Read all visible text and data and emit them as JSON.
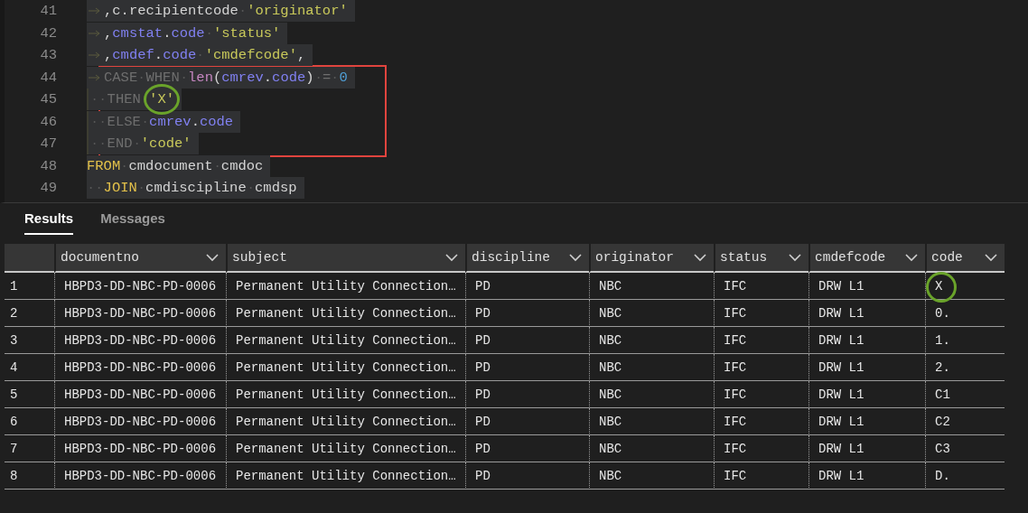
{
  "editor": {
    "lines": [
      {
        "number": "41",
        "tokens": [
          {
            "kind": "tab"
          },
          {
            "kind": "plain",
            "text": ",c.recipientcode"
          },
          {
            "kind": "space"
          },
          {
            "kind": "string",
            "text": "'originator'"
          }
        ]
      },
      {
        "number": "42",
        "tokens": [
          {
            "kind": "tab"
          },
          {
            "kind": "plain",
            "text": ","
          },
          {
            "kind": "ident",
            "text": "cmstat"
          },
          {
            "kind": "plain",
            "text": "."
          },
          {
            "kind": "ident",
            "text": "code"
          },
          {
            "kind": "space"
          },
          {
            "kind": "string",
            "text": "'status'"
          }
        ]
      },
      {
        "number": "43",
        "tokens": [
          {
            "kind": "tab"
          },
          {
            "kind": "plain",
            "text": ","
          },
          {
            "kind": "ident",
            "text": "cmdef"
          },
          {
            "kind": "plain",
            "text": "."
          },
          {
            "kind": "ident",
            "text": "code"
          },
          {
            "kind": "space"
          },
          {
            "kind": "string",
            "text": "'cmdefcode'"
          },
          {
            "kind": "plain",
            "text": ","
          }
        ]
      },
      {
        "number": "44",
        "boxed": true,
        "tokens": [
          {
            "kind": "tab"
          },
          {
            "kind": "dim",
            "text": "CASE"
          },
          {
            "kind": "space"
          },
          {
            "kind": "dim",
            "text": "WHEN"
          },
          {
            "kind": "space"
          },
          {
            "kind": "fn",
            "text": "len"
          },
          {
            "kind": "plain",
            "text": "("
          },
          {
            "kind": "ident",
            "text": "cmrev"
          },
          {
            "kind": "plain",
            "text": "."
          },
          {
            "kind": "ident",
            "text": "code"
          },
          {
            "kind": "plain",
            "text": ")"
          },
          {
            "kind": "space"
          },
          {
            "kind": "dim",
            "text": "="
          },
          {
            "kind": "space"
          },
          {
            "kind": "number",
            "text": "0"
          }
        ]
      },
      {
        "number": "45",
        "boxed": true,
        "tokens": [
          {
            "kind": "guide"
          },
          {
            "kind": "space"
          },
          {
            "kind": "space"
          },
          {
            "kind": "dim",
            "text": "THEN"
          },
          {
            "kind": "space"
          },
          {
            "kind": "string",
            "text": "'X'",
            "circled": true
          }
        ]
      },
      {
        "number": "46",
        "boxed": true,
        "tokens": [
          {
            "kind": "guide"
          },
          {
            "kind": "space"
          },
          {
            "kind": "space"
          },
          {
            "kind": "dim",
            "text": "ELSE"
          },
          {
            "kind": "space"
          },
          {
            "kind": "ident",
            "text": "cmrev"
          },
          {
            "kind": "plain",
            "text": "."
          },
          {
            "kind": "ident",
            "text": "code"
          }
        ]
      },
      {
        "number": "47",
        "boxed": true,
        "tokens": [
          {
            "kind": "guide"
          },
          {
            "kind": "space"
          },
          {
            "kind": "space"
          },
          {
            "kind": "dim",
            "text": "END"
          },
          {
            "kind": "space"
          },
          {
            "kind": "string",
            "text": "'code'"
          }
        ]
      },
      {
        "number": "48",
        "tokens": [
          {
            "kind": "keyword",
            "text": "FROM"
          },
          {
            "kind": "space"
          },
          {
            "kind": "plain",
            "text": "cmdocument"
          },
          {
            "kind": "space"
          },
          {
            "kind": "plain",
            "text": "cmdoc"
          }
        ]
      },
      {
        "number": "49",
        "tokens": [
          {
            "kind": "space"
          },
          {
            "kind": "space"
          },
          {
            "kind": "keyword",
            "text": "JOIN"
          },
          {
            "kind": "space"
          },
          {
            "kind": "plain",
            "text": "cmdiscipline"
          },
          {
            "kind": "space"
          },
          {
            "kind": "plain",
            "text": "cmdsp"
          }
        ]
      }
    ]
  },
  "result_tabs": [
    {
      "label": "Results",
      "selected": true
    },
    {
      "label": "Messages",
      "selected": false
    }
  ],
  "table": {
    "columns": [
      "documentno",
      "subject",
      "discipline",
      "originator",
      "status",
      "cmdefcode",
      "code"
    ],
    "rows": [
      {
        "number": "1",
        "cells": [
          "HBPD3-DD-NBC-PD-0006",
          "Permanent Utility Connection…",
          "PD",
          "NBC",
          "IFC",
          "DRW L1",
          "X"
        ],
        "code_circled": true
      },
      {
        "number": "2",
        "cells": [
          "HBPD3-DD-NBC-PD-0006",
          "Permanent Utility Connection…",
          "PD",
          "NBC",
          "IFC",
          "DRW L1",
          "0."
        ],
        "code_circled": false
      },
      {
        "number": "3",
        "cells": [
          "HBPD3-DD-NBC-PD-0006",
          "Permanent Utility Connection…",
          "PD",
          "NBC",
          "IFC",
          "DRW L1",
          "1."
        ],
        "code_circled": false
      },
      {
        "number": "4",
        "cells": [
          "HBPD3-DD-NBC-PD-0006",
          "Permanent Utility Connection…",
          "PD",
          "NBC",
          "IFC",
          "DRW L1",
          "2."
        ],
        "code_circled": false
      },
      {
        "number": "5",
        "cells": [
          "HBPD3-DD-NBC-PD-0006",
          "Permanent Utility Connection…",
          "PD",
          "NBC",
          "IFC",
          "DRW L1",
          "C1"
        ],
        "code_circled": false
      },
      {
        "number": "6",
        "cells": [
          "HBPD3-DD-NBC-PD-0006",
          "Permanent Utility Connection…",
          "PD",
          "NBC",
          "IFC",
          "DRW L1",
          "C2"
        ],
        "code_circled": false
      },
      {
        "number": "7",
        "cells": [
          "HBPD3-DD-NBC-PD-0006",
          "Permanent Utility Connection…",
          "PD",
          "NBC",
          "IFC",
          "DRW L1",
          "C3"
        ],
        "code_circled": false
      },
      {
        "number": "8",
        "cells": [
          "HBPD3-DD-NBC-PD-0006",
          "Permanent Utility Connection…",
          "PD",
          "NBC",
          "IFC",
          "DRW L1",
          "D."
        ],
        "code_circled": false
      }
    ]
  }
}
